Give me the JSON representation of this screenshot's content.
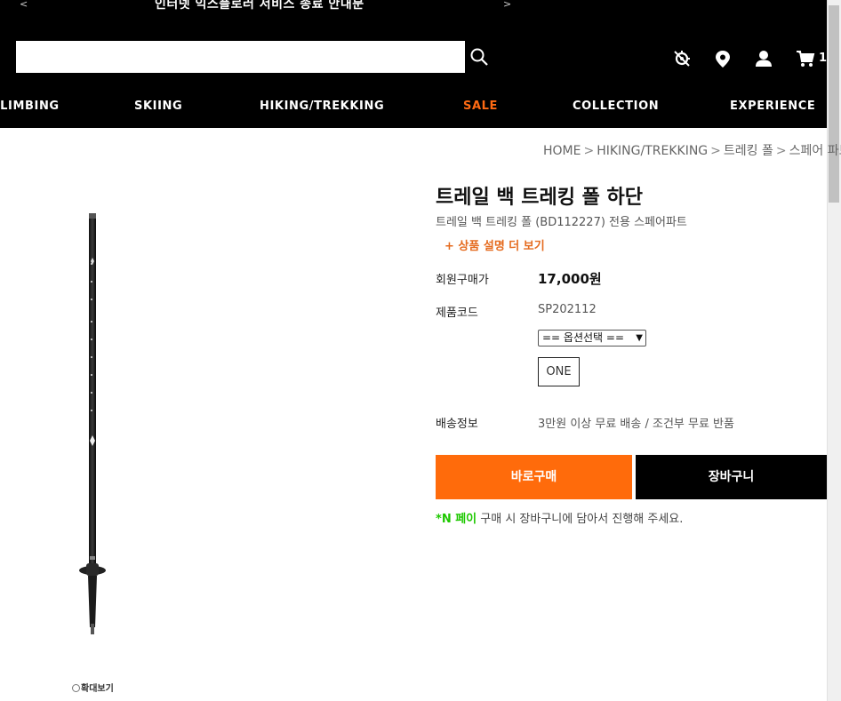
{
  "header": {
    "notice": {
      "prev": "<",
      "text": "인터넷 익스플로러 서비스 종료 안내문",
      "next": ">"
    },
    "search_placeholder": "",
    "cart_count": "1",
    "icons": [
      "search-icon",
      "store-locator-icon",
      "location-icon",
      "user-icon",
      "cart-icon"
    ]
  },
  "gnb": {
    "items": [
      "CLIMBING",
      "SKIING",
      "HIKING/TREKKING",
      "SALE",
      "COLLECTION",
      "EXPERIENCE"
    ]
  },
  "breadcrumb": {
    "items": [
      "HOME",
      "HIKING/TREKKING",
      "트레킹 폴",
      "스페어 파트"
    ],
    "sep": ">"
  },
  "product": {
    "title": "트레일 백 트레킹 폴 하단",
    "subtitle": "트레일 백 트레킹 폴 (BD112227) 전용 스페어파트",
    "more_label": "+ 상품 설명 더 보기",
    "zoom_label": "확대보기",
    "price_label": "회원구매가",
    "price_value": "17,000원",
    "code_label": "제품코드",
    "code_value": "SP202112",
    "option_select": "== 옵션선택 ==",
    "option_value": "ONE",
    "shipping_label": "배송정보",
    "shipping_value": "3만원 이상 무료 배송 / 조건부 무료 반품",
    "buy_label": "바로구매",
    "cart_label": "장바구니",
    "npay": {
      "star": "*",
      "brand": "N 페이",
      "text": " 구매 시 장바구니에 담아서 진행해 주세요."
    }
  },
  "colors": {
    "accent": "#ff6b0b",
    "header_bg": "#000000",
    "npay": "#1ec800",
    "sale": "#ff6a13"
  }
}
